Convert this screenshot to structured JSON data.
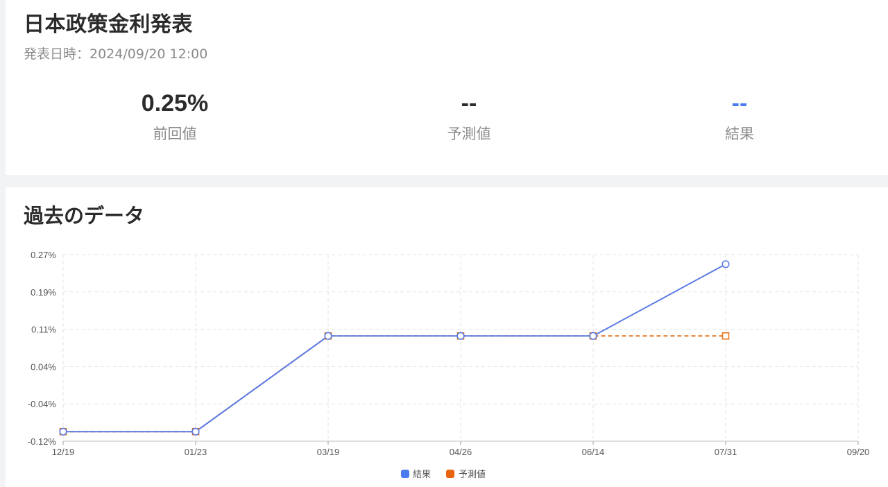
{
  "header": {
    "title": "日本政策金利発表",
    "datetime": "発表日時：2024/09/20 12:00"
  },
  "stats": {
    "previous": {
      "value": "0.25%",
      "label": "前回値"
    },
    "forecast": {
      "value": "--",
      "label": "予測値"
    },
    "result": {
      "value": "--",
      "label": "結果",
      "color": "#4a7bef"
    }
  },
  "history": {
    "title": "過去のデータ"
  },
  "colors": {
    "result": "#5b7be3",
    "forecast": "#e8771e",
    "legend_result": "#4a7bef",
    "legend_forecast": "#e8630e",
    "grid": "#e3e3e3"
  },
  "chart_data": {
    "type": "line",
    "x": [
      "12/19",
      "01/23",
      "03/19",
      "04/26",
      "06/14",
      "07/31",
      "09/20"
    ],
    "y_ticks": [
      "0.27%",
      "0.19%",
      "0.11%",
      "0.04%",
      "-0.04%",
      "-0.12%"
    ],
    "ylim": [
      -0.12,
      0.27
    ],
    "grid": true,
    "legend_position": "bottom-center",
    "series": [
      {
        "name": "結果",
        "color": "#5b7be3",
        "line_style": "solid",
        "marker": "circle",
        "values": [
          -0.1,
          -0.1,
          0.1,
          0.1,
          0.1,
          0.25,
          null
        ]
      },
      {
        "name": "予測値",
        "color": "#e8771e",
        "line_style": "dashed",
        "marker": "square",
        "values": [
          -0.1,
          -0.1,
          0.1,
          0.1,
          0.1,
          0.1,
          null
        ]
      }
    ]
  }
}
